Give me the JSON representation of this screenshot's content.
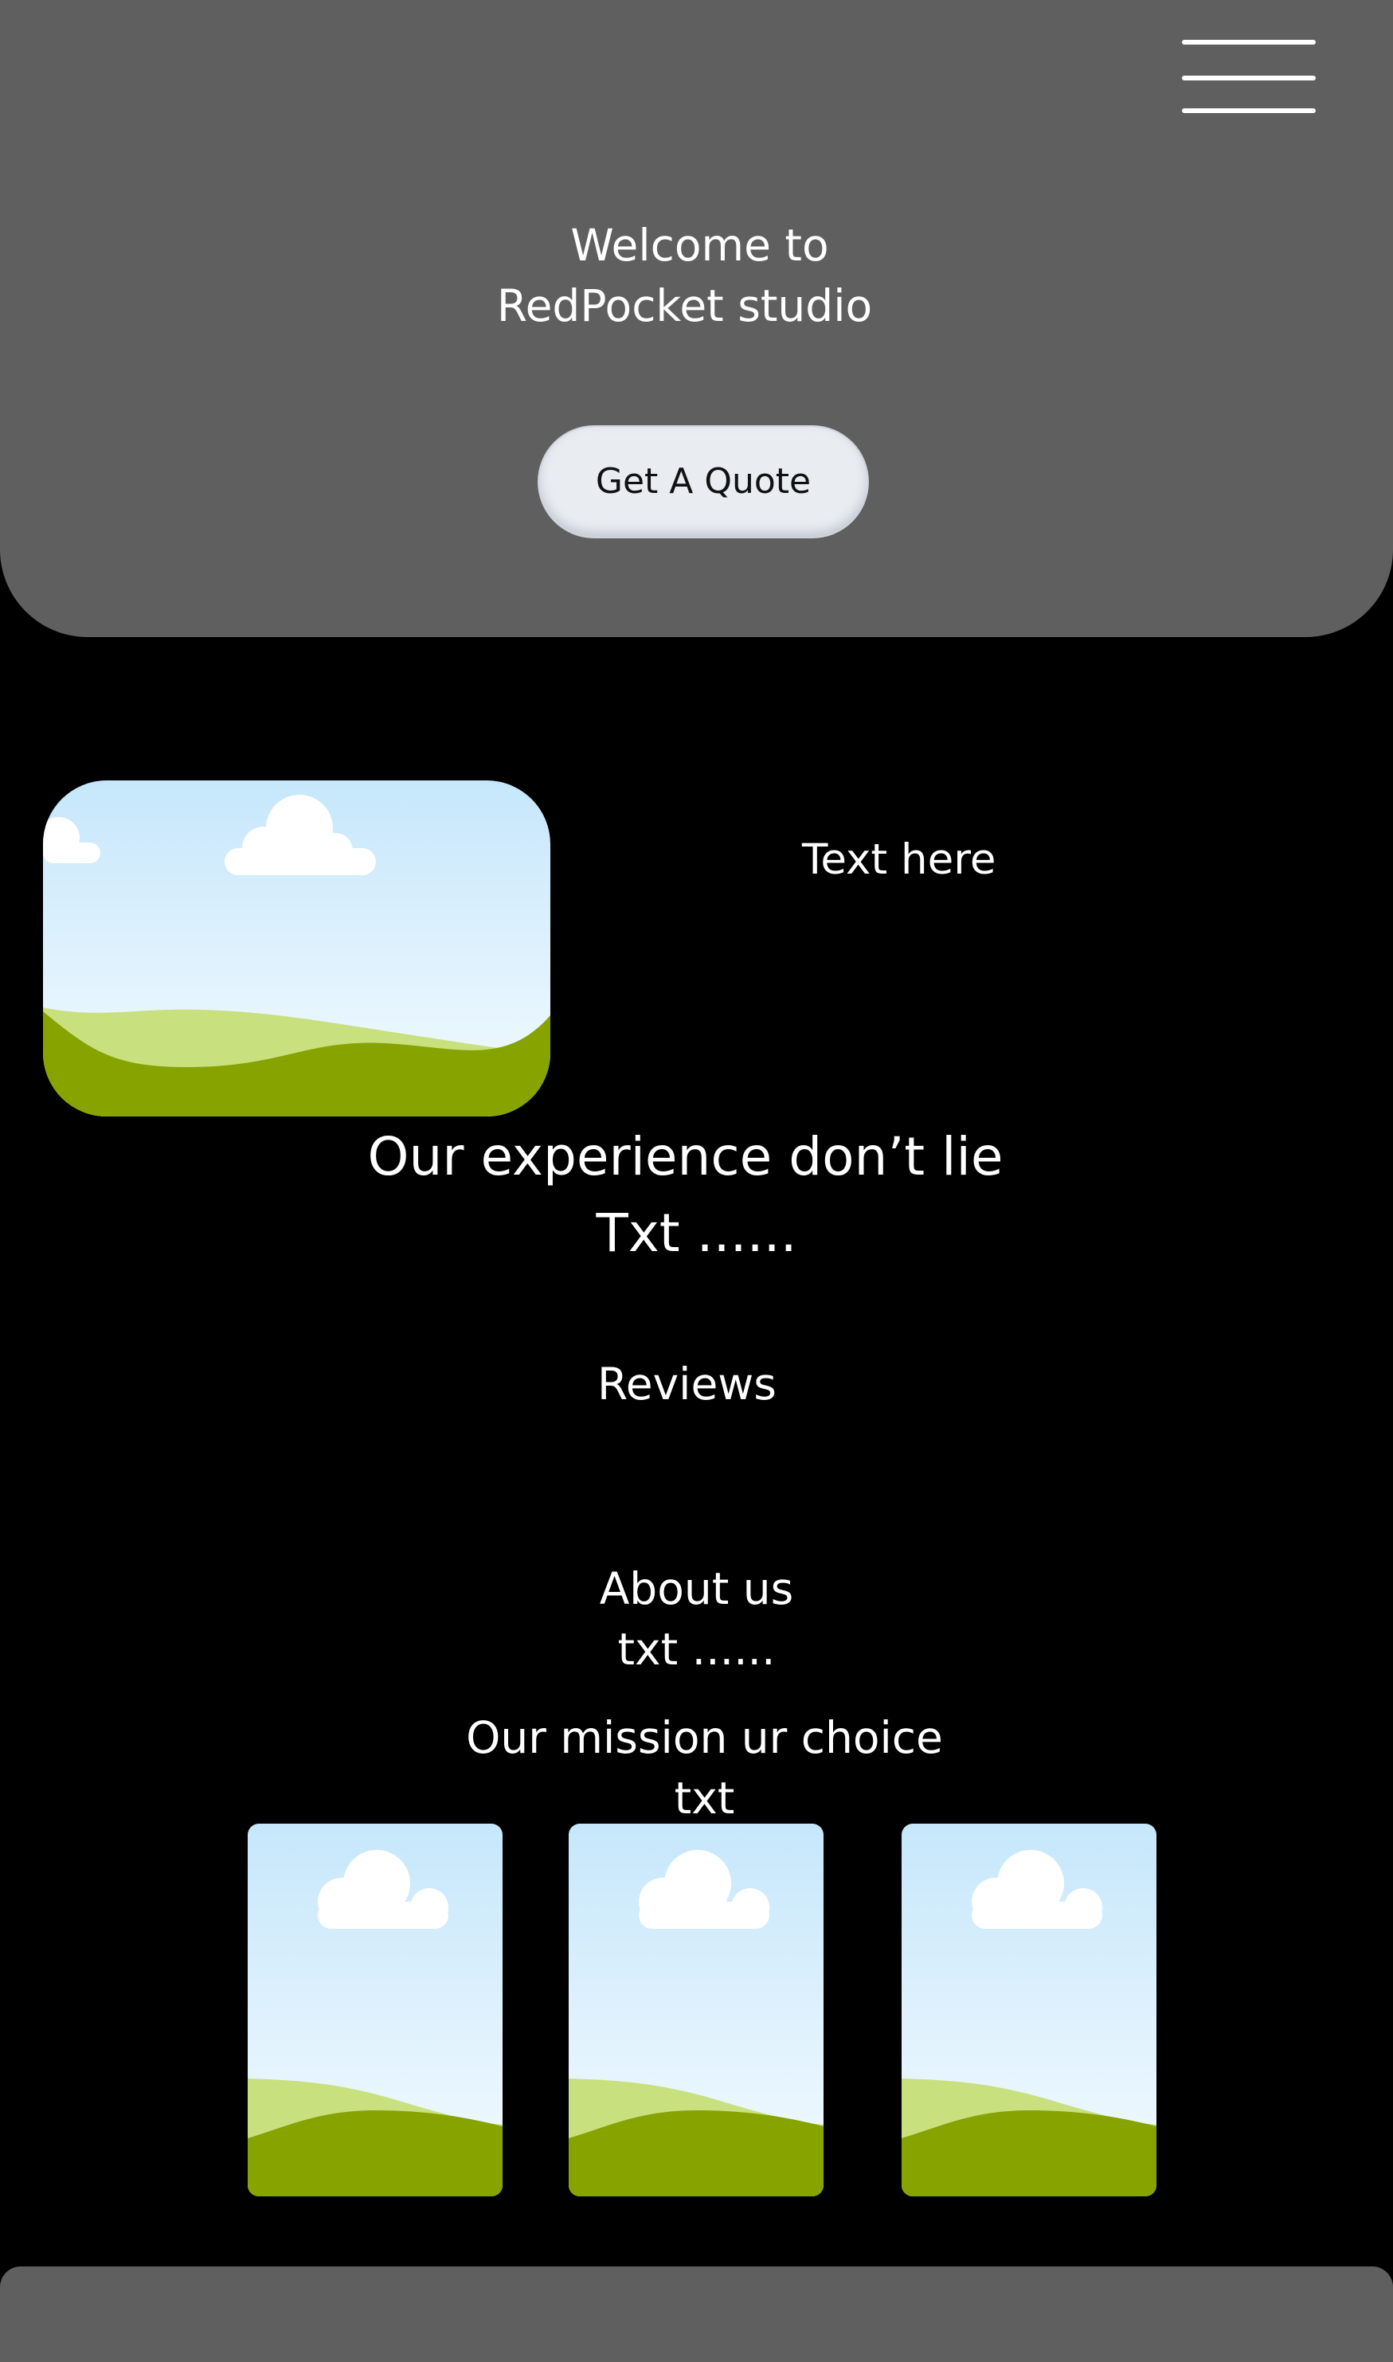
{
  "header": {
    "menu_icon": "hamburger-menu-icon",
    "welcome_line1": "Welcome to",
    "welcome_line2": "RedPocket studio",
    "cta_label": "Get A Quote"
  },
  "intro": {
    "image_icon": "landscape-image-placeholder",
    "side_text": "Text here"
  },
  "experience": {
    "heading": "Our experience don’t lie",
    "text": "Txt ......"
  },
  "reviews": {
    "heading": "Reviews"
  },
  "about": {
    "heading": "About us",
    "text": "txt ......"
  },
  "mission": {
    "heading": "Our mission ur choice",
    "text": "txt",
    "cards": [
      {
        "image_icon": "landscape-image-placeholder"
      },
      {
        "image_icon": "landscape-image-placeholder"
      },
      {
        "image_icon": "landscape-image-placeholder"
      }
    ]
  },
  "colors": {
    "page_background": "#000000",
    "panel_gray": "#5f5f5f",
    "button_background": "#e9ecf1",
    "text": "#ffffff",
    "sky_top": "#c6e7fb",
    "hill_light": "#c8e07e",
    "hill_dark": "#87a300"
  }
}
